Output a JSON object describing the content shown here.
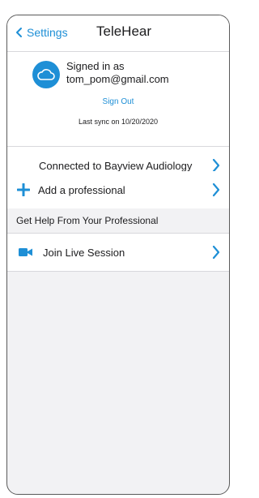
{
  "nav": {
    "back_label": "Settings",
    "title": "TeleHear"
  },
  "account": {
    "signed_in_line1": "Signed in as",
    "email": "tom_pom@gmail.com",
    "sign_out_label": "Sign Out",
    "last_sync": "Last sync on 10/20/2020"
  },
  "rows": {
    "connected": "Connected to Bayview Audiology",
    "add_professional": "Add a professional",
    "section_header": "Get Help From Your Professional",
    "live_session": "Join Live Session"
  },
  "colors": {
    "accent": "#1e8fd6",
    "background": "#f2f2f4"
  },
  "icons": {
    "back": "chevron-left-icon",
    "cloud": "cloud-icon",
    "add": "plus-icon",
    "video": "video-camera-icon",
    "row_arrow": "chevron-right-icon"
  }
}
